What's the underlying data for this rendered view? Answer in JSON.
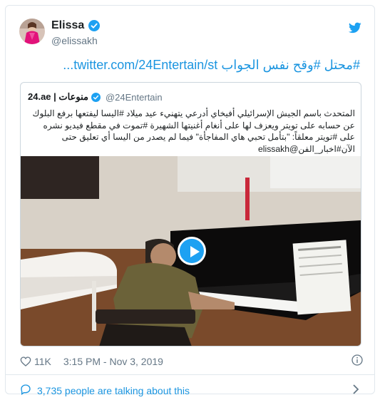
{
  "author": {
    "name": "Elissa",
    "handle": "@elissakh"
  },
  "tweet": {
    "text_prefix": "#محتل #وقح نفس الجواب ",
    "link": "twitter.com/24Entertain/st..."
  },
  "quote": {
    "name": "24.ae | منوعات",
    "handle": "@24Entertain",
    "text": "المتحدث باسم الجيش الإسرائيلي أفيخاي أدرعي يتهنيء عيد ميلاد #اليسا ليفتعها برفع البلوك عن حسابه على تويتر ويعزف لها على أنغام أغنيتها الشهيرة #تموت في مقطع فيديو نشره على #تويتر معلقاً: \"بتأمل تحبي هاي المفاجأة\" فيما لم يصدر من اليسا أي تعليق حتى الآن#اخبار_الفن@elissakh"
  },
  "footer": {
    "likes": "11K",
    "timestamp": "3:15 PM - Nov 3, 2019",
    "talking": "3,735 people are talking about this"
  },
  "colors": {
    "twitter_blue": "#1da1f2",
    "link": "#1b95e0",
    "muted": "#657786"
  }
}
